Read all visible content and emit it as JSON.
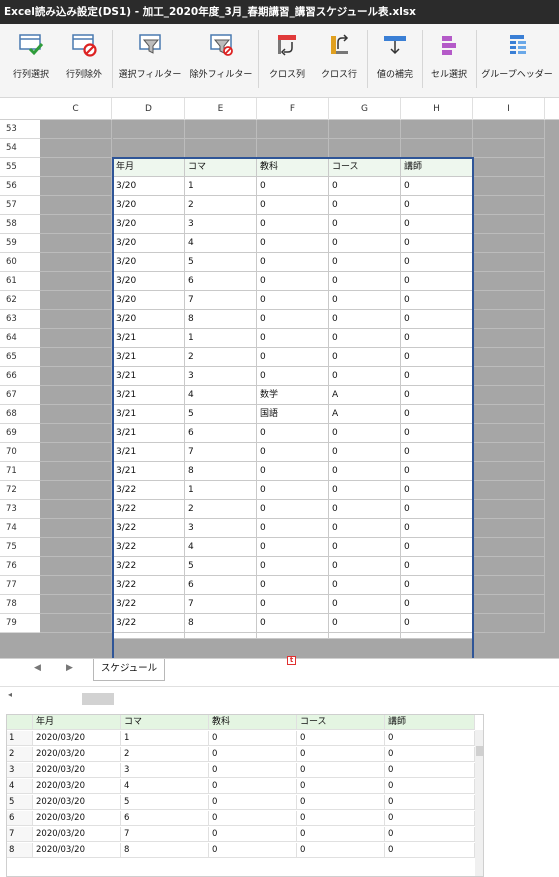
{
  "window": {
    "title": "Excel読み込み設定(DS1) - 加工_2020年度_3月_春期講習_講習スケジュール表.xlsx"
  },
  "ribbon": {
    "buttons": [
      {
        "label": "行列選択",
        "icon": "select-rows-icon"
      },
      {
        "label": "行列除外",
        "icon": "exclude-rows-icon"
      },
      {
        "label": "選択フィルター",
        "icon": "select-filter-icon"
      },
      {
        "label": "除外フィルター",
        "icon": "exclude-filter-icon"
      },
      {
        "label": "クロス列",
        "icon": "cross-column-icon"
      },
      {
        "label": "クロス行",
        "icon": "cross-row-icon"
      },
      {
        "label": "値の補完",
        "icon": "value-fill-icon"
      },
      {
        "label": "セル選択",
        "icon": "cell-select-icon"
      },
      {
        "label": "グループヘッダー",
        "icon": "group-header-icon"
      }
    ]
  },
  "sheet": {
    "columns": [
      "C",
      "D",
      "E",
      "F",
      "G",
      "H",
      "I"
    ],
    "row_numbers": [
      "53",
      "54",
      "55",
      "56",
      "57",
      "58",
      "59",
      "60",
      "61",
      "62",
      "63",
      "64",
      "65",
      "66",
      "67",
      "68",
      "69",
      "70",
      "71",
      "72",
      "73",
      "74",
      "75",
      "76",
      "77",
      "78",
      "79"
    ],
    "table_header": [
      "年月",
      "コマ",
      "教科",
      "コース",
      "講師"
    ],
    "table_rows": [
      [
        "3/20",
        "1",
        "0",
        "0",
        "0"
      ],
      [
        "3/20",
        "2",
        "0",
        "0",
        "0"
      ],
      [
        "3/20",
        "3",
        "0",
        "0",
        "0"
      ],
      [
        "3/20",
        "4",
        "0",
        "0",
        "0"
      ],
      [
        "3/20",
        "5",
        "0",
        "0",
        "0"
      ],
      [
        "3/20",
        "6",
        "0",
        "0",
        "0"
      ],
      [
        "3/20",
        "7",
        "0",
        "0",
        "0"
      ],
      [
        "3/20",
        "8",
        "0",
        "0",
        "0"
      ],
      [
        "3/21",
        "1",
        "0",
        "0",
        "0"
      ],
      [
        "3/21",
        "2",
        "0",
        "0",
        "0"
      ],
      [
        "3/21",
        "3",
        "0",
        "0",
        "0"
      ],
      [
        "3/21",
        "4",
        "数学",
        "A",
        "0"
      ],
      [
        "3/21",
        "5",
        "国語",
        "A",
        "0"
      ],
      [
        "3/21",
        "6",
        "0",
        "0",
        "0"
      ],
      [
        "3/21",
        "7",
        "0",
        "0",
        "0"
      ],
      [
        "3/21",
        "8",
        "0",
        "0",
        "0"
      ],
      [
        "3/22",
        "1",
        "0",
        "0",
        "0"
      ],
      [
        "3/22",
        "2",
        "0",
        "0",
        "0"
      ],
      [
        "3/22",
        "3",
        "0",
        "0",
        "0"
      ],
      [
        "3/22",
        "4",
        "0",
        "0",
        "0"
      ],
      [
        "3/22",
        "5",
        "0",
        "0",
        "0"
      ],
      [
        "3/22",
        "6",
        "0",
        "0",
        "0"
      ],
      [
        "3/22",
        "7",
        "0",
        "0",
        "0"
      ],
      [
        "3/22",
        "8",
        "0",
        "0",
        "0"
      ]
    ]
  },
  "tabs": {
    "sheet_tab": "スケジュール"
  },
  "preview": {
    "header": [
      "年月",
      "コマ",
      "教科",
      "コース",
      "講師"
    ],
    "rows": [
      [
        "1",
        "2020/03/20",
        "1",
        "0",
        "0",
        "0"
      ],
      [
        "2",
        "2020/03/20",
        "2",
        "0",
        "0",
        "0"
      ],
      [
        "3",
        "2020/03/20",
        "3",
        "0",
        "0",
        "0"
      ],
      [
        "4",
        "2020/03/20",
        "4",
        "0",
        "0",
        "0"
      ],
      [
        "5",
        "2020/03/20",
        "5",
        "0",
        "0",
        "0"
      ],
      [
        "6",
        "2020/03/20",
        "6",
        "0",
        "0",
        "0"
      ],
      [
        "7",
        "2020/03/20",
        "7",
        "0",
        "0",
        "0"
      ],
      [
        "8",
        "2020/03/20",
        "8",
        "0",
        "0",
        "0"
      ]
    ]
  }
}
